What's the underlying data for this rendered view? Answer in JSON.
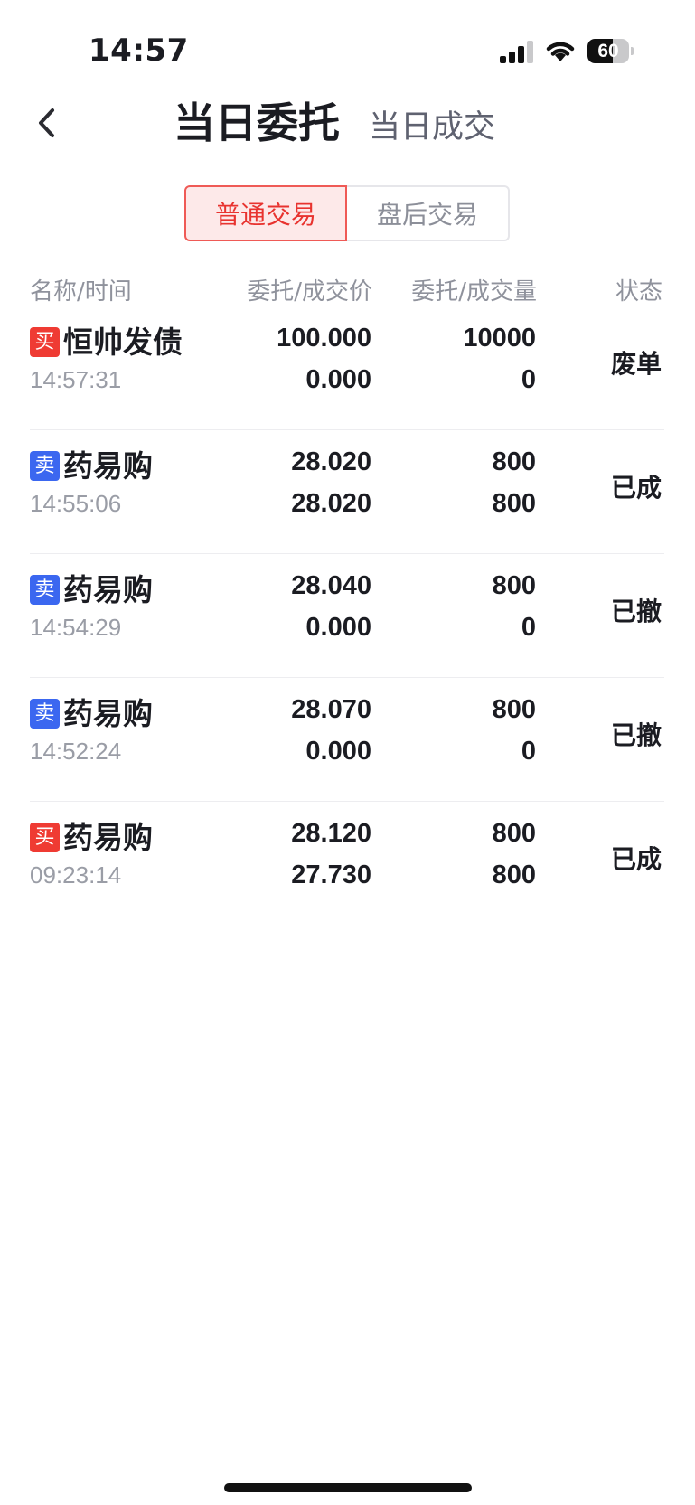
{
  "status_bar": {
    "time": "14:57",
    "battery": "60",
    "battery_level": 0.6
  },
  "header": {
    "active_title": "当日委托",
    "inactive_title": "当日成交"
  },
  "segments": {
    "normal": "普通交易",
    "after_hours": "盘后交易",
    "selected": "普通交易"
  },
  "columns": {
    "name_time": "名称/时间",
    "price": "委托/成交价",
    "qty": "委托/成交量",
    "status": "状态"
  },
  "colors": {
    "buy": "#ef3b33",
    "sell": "#3b67f0",
    "accent": "#e8332f"
  },
  "orders": [
    {
      "side": "买",
      "side_type": "buy",
      "name": "恒帅发债",
      "time": "14:57:31",
      "order_price": "100.000",
      "deal_price": "0.000",
      "order_qty": "10000",
      "deal_qty": "0",
      "status": "废单"
    },
    {
      "side": "卖",
      "side_type": "sell",
      "name": "药易购",
      "time": "14:55:06",
      "order_price": "28.020",
      "deal_price": "28.020",
      "order_qty": "800",
      "deal_qty": "800",
      "status": "已成"
    },
    {
      "side": "卖",
      "side_type": "sell",
      "name": "药易购",
      "time": "14:54:29",
      "order_price": "28.040",
      "deal_price": "0.000",
      "order_qty": "800",
      "deal_qty": "0",
      "status": "已撤"
    },
    {
      "side": "卖",
      "side_type": "sell",
      "name": "药易购",
      "time": "14:52:24",
      "order_price": "28.070",
      "deal_price": "0.000",
      "order_qty": "800",
      "deal_qty": "0",
      "status": "已撤"
    },
    {
      "side": "买",
      "side_type": "buy",
      "name": "药易购",
      "time": "09:23:14",
      "order_price": "28.120",
      "deal_price": "27.730",
      "order_qty": "800",
      "deal_qty": "800",
      "status": "已成"
    }
  ]
}
